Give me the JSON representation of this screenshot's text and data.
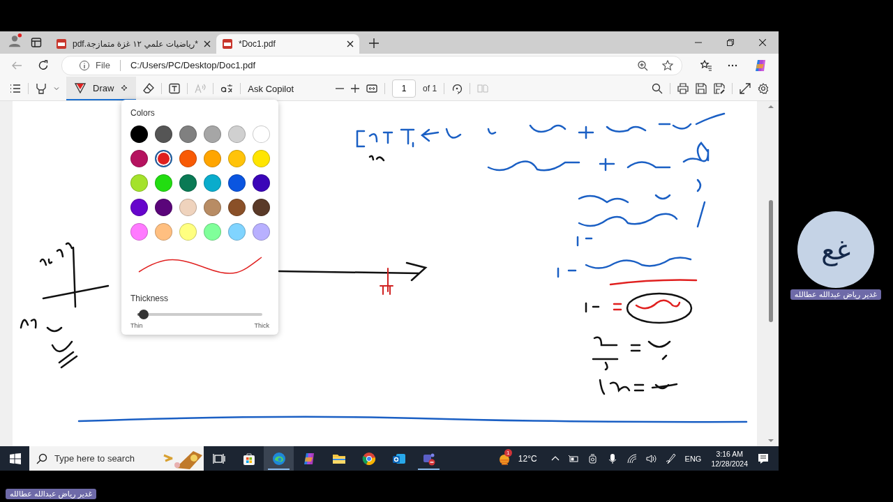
{
  "browser": {
    "tabs": [
      {
        "title": "*رياضيات علمي ١٢ غزة متمازجة.pdf",
        "selected": false
      },
      {
        "title": "*Doc1.pdf",
        "selected": true
      }
    ],
    "address": {
      "label": "File",
      "url": "C:/Users/PC/Desktop/Doc1.pdf"
    }
  },
  "pdf_toolbar": {
    "draw_label": "Draw",
    "draw_selected": true,
    "ask_copilot": "Ask Copilot",
    "page": "1",
    "page_count": "of 1"
  },
  "color_panel": {
    "title": "Colors",
    "colors": [
      {
        "color": "#000000",
        "selected": false
      },
      {
        "color": "#555555",
        "selected": false
      },
      {
        "color": "#808080",
        "selected": false
      },
      {
        "color": "#a6a6a6",
        "selected": false
      },
      {
        "color": "#d0d0d0",
        "selected": false
      },
      {
        "color": "#ffffff",
        "selected": false
      },
      {
        "color": "#b5125f",
        "selected": false
      },
      {
        "color": "#e0201f",
        "selected": true
      },
      {
        "color": "#f85a05",
        "selected": false
      },
      {
        "color": "#ffa500",
        "selected": false
      },
      {
        "color": "#ffc30a",
        "selected": false
      },
      {
        "color": "#ffe500",
        "selected": false
      },
      {
        "color": "#a4e22b",
        "selected": false
      },
      {
        "color": "#22dd11",
        "selected": false
      },
      {
        "color": "#0a7a55",
        "selected": false
      },
      {
        "color": "#0aaccc",
        "selected": false
      },
      {
        "color": "#0a55e0",
        "selected": false
      },
      {
        "color": "#3a05b8",
        "selected": false
      },
      {
        "color": "#6605cc",
        "selected": false
      },
      {
        "color": "#5a057a",
        "selected": false
      },
      {
        "color": "#efd3bd",
        "selected": false
      },
      {
        "color": "#b88c64",
        "selected": false
      },
      {
        "color": "#8a5028",
        "selected": false
      },
      {
        "color": "#5a3a28",
        "selected": false
      },
      {
        "color": "#ff7aff",
        "selected": false
      },
      {
        "color": "#ffbf80",
        "selected": false
      },
      {
        "color": "#ffff80",
        "selected": false
      },
      {
        "color": "#80ff9a",
        "selected": false
      },
      {
        "color": "#80d4ff",
        "selected": false
      },
      {
        "color": "#b8b0ff",
        "selected": false
      }
    ],
    "thickness": {
      "label": "Thickness",
      "level": 0.05,
      "min_label": "Thin",
      "max_label": "Thick"
    }
  },
  "taskbar": {
    "search_placeholder": "Type here to search",
    "apps": [
      {
        "kind": "taskview",
        "selected": false,
        "open": false
      },
      {
        "kind": "store",
        "selected": false,
        "open": false
      },
      {
        "kind": "edge",
        "selected": true,
        "open": true
      },
      {
        "kind": "copilot",
        "selected": false,
        "open": false
      },
      {
        "kind": "explorer",
        "selected": false,
        "open": false
      },
      {
        "kind": "chrome",
        "selected": false,
        "open": false
      },
      {
        "kind": "outlook",
        "selected": false,
        "open": false
      },
      {
        "kind": "teams",
        "selected": false,
        "open": true
      }
    ],
    "weather_badge": "1",
    "temperature": "12°C",
    "language": "ENG",
    "time": "3:16 AM",
    "date": "12/28/2024"
  },
  "participant": {
    "initials": "غع",
    "name": "غدير رياض عبدالله عطالله"
  },
  "caption": "غدير رياض عبدالله عطالله"
}
